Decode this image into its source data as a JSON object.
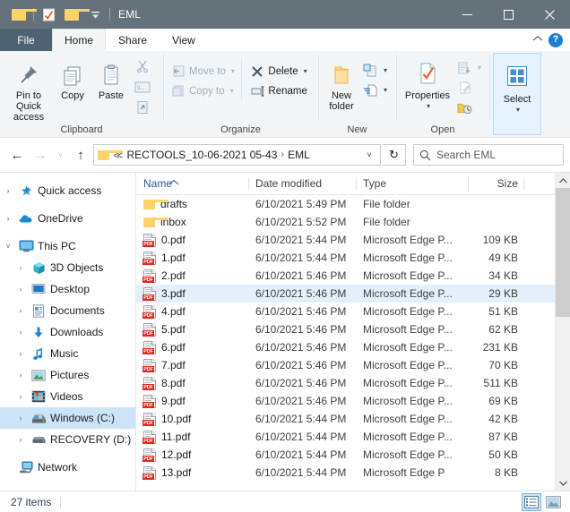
{
  "window": {
    "title": "EML",
    "quick_access_icons": [
      "folder-icon",
      "properties-check-icon",
      "new-folder-icon",
      "customize-qat-icon"
    ],
    "controls": {
      "minimize": "—",
      "maximize": "□",
      "close": "✕"
    }
  },
  "tabs": {
    "file": "File",
    "items": [
      {
        "label": "Home",
        "active": true
      },
      {
        "label": "Share",
        "active": false
      },
      {
        "label": "View",
        "active": false
      }
    ],
    "collapse_ribbon": "^",
    "help": "?"
  },
  "ribbon": {
    "groups": [
      {
        "label": "Clipboard",
        "big_buttons": [
          {
            "label": "Pin to Quick access",
            "icon": "pin-icon"
          },
          {
            "label": "Copy",
            "icon": "copy-icon"
          },
          {
            "label": "Paste",
            "icon": "paste-icon"
          }
        ],
        "small_buttons": [
          {
            "label": "Cut",
            "icon": "scissors-icon",
            "disabled": true
          },
          {
            "label": "Copy path",
            "icon": "copy-path-icon",
            "disabled": true
          },
          {
            "label": "Paste shortcut",
            "icon": "paste-shortcut-icon",
            "disabled": true
          }
        ]
      },
      {
        "label": "Organize",
        "small_buttons": [
          {
            "label": "Move to",
            "icon": "move-to-icon",
            "disabled": true,
            "dropdown": true
          },
          {
            "label": "Copy to",
            "icon": "copy-to-icon",
            "disabled": true,
            "dropdown": true
          },
          {
            "label": "Delete",
            "icon": "delete-x-icon",
            "disabled": false,
            "dropdown": true
          },
          {
            "label": "Rename",
            "icon": "rename-icon",
            "disabled": false,
            "dropdown": false
          }
        ]
      },
      {
        "label": "New",
        "big_buttons": [
          {
            "label": "New folder",
            "icon": "new-folder-icon"
          }
        ],
        "small_buttons": [
          {
            "label": "New item",
            "icon": "new-item-icon",
            "dropdown": true
          },
          {
            "label": "Easy access",
            "icon": "easy-access-icon",
            "dropdown": true
          }
        ]
      },
      {
        "label": "Open",
        "big_buttons": [
          {
            "label": "Properties",
            "icon": "properties-icon",
            "dropdown": true
          }
        ],
        "small_buttons": [
          {
            "label": "Open",
            "icon": "open-icon",
            "disabled": true,
            "dropdown": true
          },
          {
            "label": "Edit",
            "icon": "edit-icon",
            "disabled": true
          },
          {
            "label": "History",
            "icon": "history-icon",
            "disabled": false
          }
        ]
      },
      {
        "label": "",
        "big_buttons": [
          {
            "label": "Select",
            "icon": "select-grid-icon",
            "dropdown": true,
            "selected": true
          }
        ]
      }
    ]
  },
  "address": {
    "back": "←",
    "forward": "→",
    "recent": "˅",
    "up": "↑",
    "folder_icon": "folder-icon",
    "overflow": "≪",
    "crumbs": [
      "RECTOOLS_10-06-2021 05-43",
      "EML"
    ],
    "dropdown": "˅",
    "refresh": "↻",
    "search_placeholder": "Search EML",
    "search_value": "",
    "search_icon": "search-icon"
  },
  "navpane": {
    "items": [
      {
        "label": "Quick access",
        "icon": "star-pin-icon",
        "expander": "›",
        "level": 1,
        "selected": false
      },
      {
        "label": "OneDrive",
        "icon": "cloud-icon",
        "expander": "›",
        "level": 1,
        "selected": false
      },
      {
        "label": "This PC",
        "icon": "monitor-icon",
        "expander": "˅",
        "level": 1,
        "selected": false
      },
      {
        "label": "3D Objects",
        "icon": "cube-icon",
        "expander": "›",
        "level": 2,
        "selected": false
      },
      {
        "label": "Desktop",
        "icon": "desktop-icon",
        "expander": "›",
        "level": 2,
        "selected": false
      },
      {
        "label": "Documents",
        "icon": "documents-icon",
        "expander": "›",
        "level": 2,
        "selected": false
      },
      {
        "label": "Downloads",
        "icon": "download-arrow-icon",
        "expander": "›",
        "level": 2,
        "selected": false
      },
      {
        "label": "Music",
        "icon": "music-note-icon",
        "expander": "›",
        "level": 2,
        "selected": false
      },
      {
        "label": "Pictures",
        "icon": "picture-icon",
        "expander": "›",
        "level": 2,
        "selected": false
      },
      {
        "label": "Videos",
        "icon": "video-icon",
        "expander": "›",
        "level": 2,
        "selected": false
      },
      {
        "label": "Windows (C:)",
        "icon": "drive-icon",
        "expander": "›",
        "level": 2,
        "selected": true
      },
      {
        "label": "RECOVERY (D:)",
        "icon": "drive-icon",
        "expander": "›",
        "level": 2,
        "selected": false
      },
      {
        "label": "Network",
        "icon": "network-icon",
        "expander": "",
        "level": 1,
        "selected": false
      }
    ]
  },
  "filelist": {
    "columns": [
      {
        "key": "name",
        "label": "Name",
        "sorted": true,
        "sort_dir": "asc"
      },
      {
        "key": "date",
        "label": "Date modified"
      },
      {
        "key": "type",
        "label": "Type"
      },
      {
        "key": "size",
        "label": "Size"
      }
    ],
    "rows": [
      {
        "name": "drafts",
        "date": "6/10/2021 5:49 PM",
        "type": "File folder",
        "size": "",
        "icon": "folder-icon",
        "selected": false
      },
      {
        "name": "inbox",
        "date": "6/10/2021 5:52 PM",
        "type": "File folder",
        "size": "",
        "icon": "folder-icon",
        "selected": false
      },
      {
        "name": "0.pdf",
        "date": "6/10/2021 5:44 PM",
        "type": "Microsoft Edge P...",
        "size": "109 KB",
        "icon": "pdf-icon",
        "selected": false
      },
      {
        "name": "1.pdf",
        "date": "6/10/2021 5:44 PM",
        "type": "Microsoft Edge P...",
        "size": "49 KB",
        "icon": "pdf-icon",
        "selected": false
      },
      {
        "name": "2.pdf",
        "date": "6/10/2021 5:46 PM",
        "type": "Microsoft Edge P...",
        "size": "34 KB",
        "icon": "pdf-icon",
        "selected": false
      },
      {
        "name": "3.pdf",
        "date": "6/10/2021 5:46 PM",
        "type": "Microsoft Edge P...",
        "size": "29 KB",
        "icon": "pdf-icon",
        "selected": true
      },
      {
        "name": "4.pdf",
        "date": "6/10/2021 5:46 PM",
        "type": "Microsoft Edge P...",
        "size": "51 KB",
        "icon": "pdf-icon",
        "selected": false
      },
      {
        "name": "5.pdf",
        "date": "6/10/2021 5:46 PM",
        "type": "Microsoft Edge P...",
        "size": "62 KB",
        "icon": "pdf-icon",
        "selected": false
      },
      {
        "name": "6.pdf",
        "date": "6/10/2021 5:46 PM",
        "type": "Microsoft Edge P...",
        "size": "231 KB",
        "icon": "pdf-icon",
        "selected": false
      },
      {
        "name": "7.pdf",
        "date": "6/10/2021 5:46 PM",
        "type": "Microsoft Edge P...",
        "size": "70 KB",
        "icon": "pdf-icon",
        "selected": false
      },
      {
        "name": "8.pdf",
        "date": "6/10/2021 5:46 PM",
        "type": "Microsoft Edge P...",
        "size": "511 KB",
        "icon": "pdf-icon",
        "selected": false
      },
      {
        "name": "9.pdf",
        "date": "6/10/2021 5:46 PM",
        "type": "Microsoft Edge P...",
        "size": "69 KB",
        "icon": "pdf-icon",
        "selected": false
      },
      {
        "name": "10.pdf",
        "date": "6/10/2021 5:44 PM",
        "type": "Microsoft Edge P...",
        "size": "42 KB",
        "icon": "pdf-icon",
        "selected": false
      },
      {
        "name": "11.pdf",
        "date": "6/10/2021 5:44 PM",
        "type": "Microsoft Edge P...",
        "size": "87 KB",
        "icon": "pdf-icon",
        "selected": false
      },
      {
        "name": "12.pdf",
        "date": "6/10/2021 5:44 PM",
        "type": "Microsoft Edge P...",
        "size": "50 KB",
        "icon": "pdf-icon",
        "selected": false
      },
      {
        "name": "13.pdf",
        "date": "6/10/2021 5:44 PM",
        "type": "Microsoft Edge P",
        "size": "8 KB",
        "icon": "pdf-icon",
        "selected": false
      }
    ]
  },
  "statusbar": {
    "item_count": "27 items",
    "views": [
      {
        "name": "details-view",
        "selected": true
      },
      {
        "name": "large-icons-view",
        "selected": false
      }
    ]
  },
  "colors": {
    "titlebar": "#667279",
    "file_tab": "#4f6271",
    "ribbon_bg": "#f2f5f8",
    "selection": "#cce4f7",
    "row_selection": "#e3f0fb",
    "column_header_text": "#2a5699",
    "pdf_red": "#e1261d",
    "folder_yellow": "#ffd36b",
    "accent_blue": "#1a7fd4"
  }
}
